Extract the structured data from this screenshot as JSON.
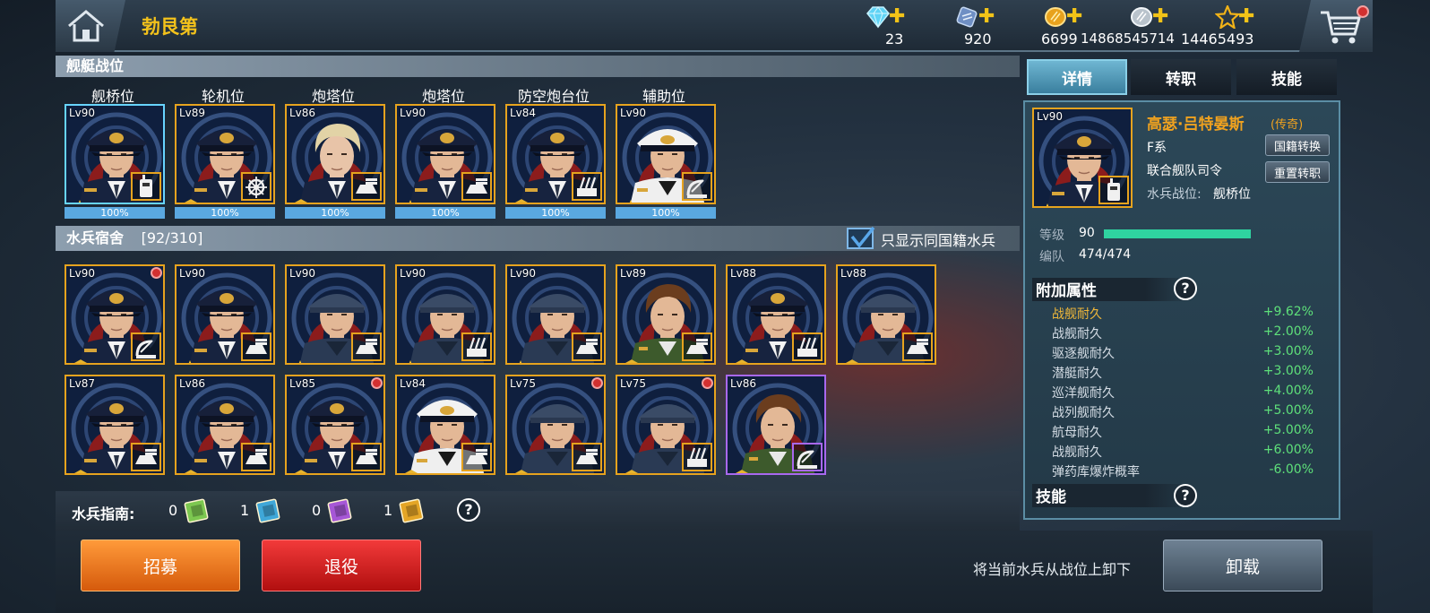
{
  "header": {
    "title": "勃艮第"
  },
  "resources": [
    {
      "icon": "diamond-icon",
      "value": "23"
    },
    {
      "icon": "ticket-icon",
      "value": "920"
    },
    {
      "icon": "gold-coin-icon",
      "value": "6699"
    },
    {
      "icon": "silver-coin-icon",
      "value": "14868545714"
    },
    {
      "icon": "star-icon",
      "value": "14465493"
    }
  ],
  "positions": {
    "header": "舰艇战位",
    "slots": [
      {
        "label": "舰桥位",
        "level": "Lv90",
        "progress": "100%",
        "kind": "officer",
        "rank": "star",
        "role": "radio",
        "selected": true
      },
      {
        "label": "轮机位",
        "level": "Lv89",
        "progress": "100%",
        "kind": "officer",
        "rank": "chevron",
        "role": "wheel"
      },
      {
        "label": "炮塔位",
        "level": "Lv86",
        "progress": "100%",
        "kind": "blond",
        "rank": "chevron",
        "role": "turret"
      },
      {
        "label": "炮塔位",
        "level": "Lv90",
        "progress": "100%",
        "kind": "officer",
        "rank": "star",
        "role": "turret"
      },
      {
        "label": "防空炮台位",
        "level": "Lv84",
        "progress": "100%",
        "kind": "officer",
        "rank": "chevron",
        "role": "aa"
      },
      {
        "label": "辅助位",
        "level": "Lv90",
        "progress": "100%",
        "kind": "white",
        "rank": "star",
        "role": "radar"
      }
    ]
  },
  "dorm": {
    "header": "水兵宿舍",
    "count": "[92/310]",
    "filter_label": "只显示同国籍水兵",
    "rows": [
      [
        {
          "level": "Lv90",
          "kind": "officer",
          "rank": "chevron",
          "role": "radar",
          "dot": true
        },
        {
          "level": "Lv90",
          "kind": "officer",
          "rank": "star",
          "role": "turret"
        },
        {
          "level": "Lv90",
          "kind": "sailor",
          "rank": "star",
          "role": "turret"
        },
        {
          "level": "Lv90",
          "kind": "sailor",
          "rank": "star",
          "role": "aa"
        },
        {
          "level": "Lv90",
          "kind": "sailor",
          "rank": "star",
          "role": "turret"
        },
        {
          "level": "Lv89",
          "kind": "green",
          "rank": "chevron",
          "role": "turret"
        },
        {
          "level": "Lv88",
          "kind": "officer",
          "rank": "chevron",
          "role": "aa"
        },
        {
          "level": "Lv88",
          "kind": "sailor",
          "rank": "chevron",
          "role": "turret"
        }
      ],
      [
        {
          "level": "Lv87",
          "kind": "officer",
          "rank": "chevron",
          "role": "turret"
        },
        {
          "level": "Lv86",
          "kind": "officer",
          "rank": "chevron",
          "role": "turret"
        },
        {
          "level": "Lv85",
          "kind": "officer",
          "rank": "chevron",
          "role": "turret",
          "dot": true
        },
        {
          "level": "Lv84",
          "kind": "white",
          "rank": "chevron",
          "role": "turret"
        },
        {
          "level": "Lv75",
          "kind": "sailor",
          "rank": "chevron",
          "role": "turret",
          "dot": true
        },
        {
          "level": "Lv75",
          "kind": "sailor",
          "rank": "chevron",
          "role": "aa",
          "dot": true
        },
        {
          "level": "Lv86",
          "kind": "green",
          "rank": "chevron",
          "role": "radar",
          "purple": true
        }
      ]
    ]
  },
  "guide": {
    "label": "水兵指南:",
    "items": [
      {
        "count": "0",
        "color": "#7cc750"
      },
      {
        "count": "1",
        "color": "#3fa7d8"
      },
      {
        "count": "0",
        "color": "#a657d6"
      },
      {
        "count": "1",
        "color": "#e4a526"
      }
    ]
  },
  "buttons": {
    "recruit": "招募",
    "retire": "退役",
    "unload_hint": "将当前水兵从战位上卸下",
    "unload": "卸载"
  },
  "tabs": [
    "详情",
    "转职",
    "技能"
  ],
  "detail": {
    "level_badge": "Lv90",
    "name": "高瑟·吕特晏斯",
    "rarity": "(传奇)",
    "faction": "F系",
    "title": "联合舰队司令",
    "position_label": "水兵战位:",
    "position_value": "舰桥位",
    "nationality_button": "国籍转换",
    "reset_button": "重置转职",
    "level_label": "等级",
    "level_value": "90",
    "level_progress": 1.0,
    "team_label": "编队",
    "team_value": "474/474"
  },
  "attributes": {
    "header": "附加属性",
    "rows": [
      {
        "name": "战舰耐久",
        "value": "+9.62%",
        "highlight": true
      },
      {
        "name": "战舰耐久",
        "value": "+2.00%"
      },
      {
        "name": "驱逐舰耐久",
        "value": "+3.00%"
      },
      {
        "name": "潜艇耐久",
        "value": "+3.00%"
      },
      {
        "name": "巡洋舰耐久",
        "value": "+4.00%"
      },
      {
        "name": "战列舰耐久",
        "value": "+5.00%"
      },
      {
        "name": "航母耐久",
        "value": "+5.00%"
      },
      {
        "name": "战舰耐久",
        "value": "+6.00%"
      },
      {
        "name": "弹药库爆炸概率",
        "value": "-6.00%"
      }
    ]
  },
  "skills": {
    "header": "技能"
  }
}
